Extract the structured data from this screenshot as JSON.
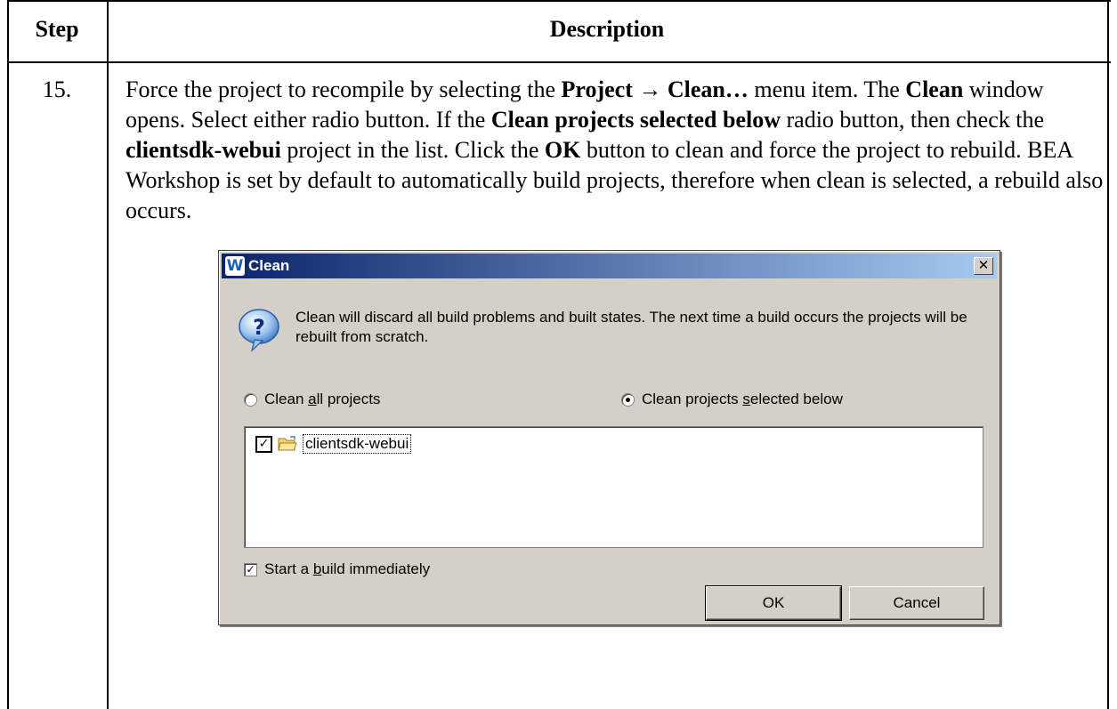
{
  "table": {
    "header_step": "Step",
    "header_description": "Description",
    "step_number": "15.",
    "description": [
      {
        "t": "Force the project to recompile by selecting the ",
        "b": false
      },
      {
        "t": "Project → Clean…",
        "b": true
      },
      {
        "t": " menu item. The ",
        "b": false
      },
      {
        "t": "Clean",
        "b": true
      },
      {
        "t": " window opens. Select either radio button. If the ",
        "b": false
      },
      {
        "t": "Clean projects selected below",
        "b": true
      },
      {
        "t": " radio button, then check the ",
        "b": false
      },
      {
        "t": "clientsdk-webui",
        "b": true
      },
      {
        "t": " project in the list. Click the ",
        "b": false
      },
      {
        "t": "OK",
        "b": true
      },
      {
        "t": " button to clean and force the project to rebuild. BEA Workshop is set by default to automatically build projects, therefore when clean is selected, a rebuild also occurs.",
        "b": false
      }
    ]
  },
  "dialog": {
    "title": "Clean",
    "app_icon_glyph": "W",
    "close_glyph": "✕",
    "message": "Clean will discard all build problems and built states.  The next time a build occurs the projects will be rebuilt from scratch.",
    "radio_all_label": "Clean all projects",
    "radio_all_selected": false,
    "radio_selected_label": "Clean projects selected below",
    "radio_selected_selected": true,
    "project_item": {
      "label": "clientsdk-webui",
      "checked": true
    },
    "build_label": "Start a build immediately",
    "build_checked": true,
    "ok_label": "OK",
    "cancel_label": "Cancel",
    "icons": {
      "help": "help-question-icon",
      "folder": "project-folder-icon"
    }
  }
}
